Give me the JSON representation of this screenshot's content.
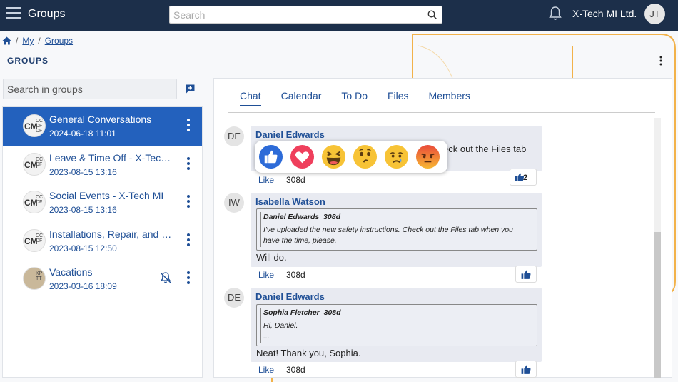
{
  "header": {
    "app_title": "Groups",
    "search_placeholder": "Search",
    "org_name": "X-Tech MI Ltd.",
    "user_initials": "JT"
  },
  "breadcrumb": [
    "My",
    "Groups"
  ],
  "groups_heading": "GROUPS",
  "group_search_placeholder": "Search in groups",
  "groups": [
    {
      "name": "General Conversations",
      "date": "2024-06-18 11:01",
      "active": true,
      "avatar": {
        "main": "CM",
        "small": [
          "CC",
          "DF",
          "DF"
        ]
      }
    },
    {
      "name": "Leave & Time Off - X-Tech MI",
      "date": "2023-08-15 13:16",
      "avatar": {
        "main": "CM",
        "small": [
          "CC",
          "DF",
          ""
        ]
      }
    },
    {
      "name": "Social Events - X-Tech MI",
      "date": "2023-08-15 13:16",
      "avatar": {
        "main": "CM",
        "small": [
          "CC",
          "DF",
          ""
        ]
      }
    },
    {
      "name": "Installations, Repair, and Maintenance",
      "date": "2023-08-15 12:50",
      "avatar": {
        "main": "CM",
        "small": [
          "CC",
          "DF",
          ""
        ]
      }
    },
    {
      "name": "Vacations",
      "date": "2023-03-16 18:09",
      "avatar": {
        "main": "",
        "small": [
          "KP",
          "TT",
          ""
        ]
      },
      "muted": true
    }
  ],
  "tabs": [
    "Chat",
    "Calendar",
    "To Do",
    "Files",
    "Members"
  ],
  "messages": [
    {
      "avatar": "DE",
      "author": "Daniel Edwards",
      "text_partial": "eck out the Files tab",
      "like_label": "Like",
      "time": "308d",
      "like_count": "2"
    },
    {
      "avatar": "IW",
      "author": "Isabella Watson",
      "quote_author": "Daniel Edwards",
      "quote_time": "308d",
      "quote_lines": [
        "I've uploaded the new safety instructions. Check out the Files tab when you",
        "have the time, please."
      ],
      "text": "Will do.",
      "like_label": "Like",
      "time": "308d"
    },
    {
      "avatar": "DE",
      "author": "Daniel Edwards",
      "quote_author": "Sophia Fletcher",
      "quote_time": "308d",
      "quote_lines": [
        "Hi, Daniel.",
        "..."
      ],
      "text": "Neat! Thank you, Sophia.",
      "like_label": "Like",
      "time": "308d"
    }
  ],
  "reactions": [
    "like",
    "love",
    "haha",
    "wow",
    "sad",
    "angry"
  ],
  "colors": {
    "header_bg": "#1c2f4a",
    "accent": "#1f4f96",
    "active_group": "#2361bd",
    "bubble": "#e8eaf1"
  }
}
